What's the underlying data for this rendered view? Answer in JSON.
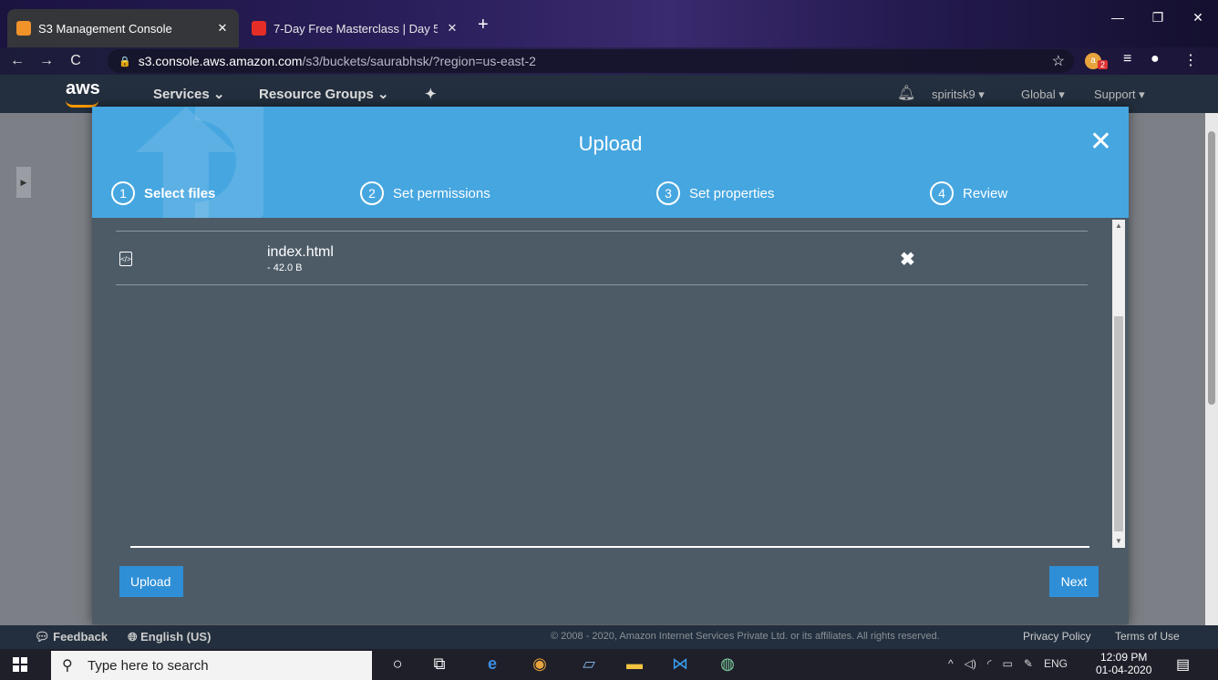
{
  "browser": {
    "tabs": [
      {
        "title": "S3 Management Console",
        "close": "✕",
        "favicon_color": "#f0932b"
      },
      {
        "title": "7-Day Free Masterclass | Day 5 -",
        "close": "✕",
        "favicon_color": "#e52d27"
      }
    ],
    "new_tab": "+",
    "window_buttons": {
      "minimize": "—",
      "maximize": "❐",
      "close": "✕"
    },
    "nav": {
      "back": "←",
      "forward": "→",
      "reload": "C"
    },
    "url_host": "s3.console.aws.amazon.com",
    "url_path": "/s3/buckets/saurabhsk/?region=us-east-2",
    "extension_badge": "2"
  },
  "aws_nav": {
    "logo": "aws",
    "services": "Services ⌄",
    "resource_groups": "Resource Groups ⌄",
    "pin": "✦",
    "username": "spiritsk9 ▾",
    "region": "Global ▾",
    "support": "Support ▾"
  },
  "modal": {
    "title": "Upload",
    "close": "✕",
    "steps": [
      {
        "num": "1",
        "label": "Select files"
      },
      {
        "num": "2",
        "label": "Set permissions"
      },
      {
        "num": "3",
        "label": "Set properties"
      },
      {
        "num": "4",
        "label": "Review"
      }
    ],
    "files": [
      {
        "name": "index.html",
        "size": "- 42.0 B",
        "remove": "✖"
      }
    ],
    "upload_button": "Upload",
    "next_button": "Next"
  },
  "footer": {
    "feedback": "Feedback",
    "language": "English (US)",
    "copyright": "© 2008 - 2020, Amazon Internet Services Private Ltd. or its affiliates. All rights reserved.",
    "privacy": "Privacy Policy",
    "terms": "Terms of Use"
  },
  "taskbar": {
    "search_placeholder": "Type here to search",
    "tray": {
      "lang": "ENG"
    },
    "time": "12:09 PM",
    "date": "01-04-2020"
  },
  "colors": {
    "modal_header": "#46a6e0",
    "modal_body": "#4d5b67",
    "button": "#2f8fd6",
    "aws_nav": "#232f3e"
  }
}
